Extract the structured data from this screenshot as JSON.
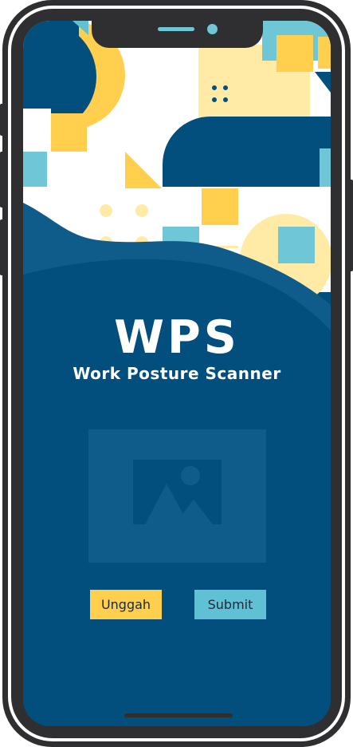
{
  "app": {
    "title": "WPS",
    "subtitle": "Work Posture Scanner"
  },
  "actions": {
    "upload_label": "Unggah",
    "submit_label": "Submit"
  },
  "image_preview": {
    "icon": "image-placeholder-icon"
  },
  "colors": {
    "navy": "#024f7d",
    "yellow": "#ffcf4d",
    "cyan": "#5fc1d3",
    "frame": "#2f2f31"
  }
}
